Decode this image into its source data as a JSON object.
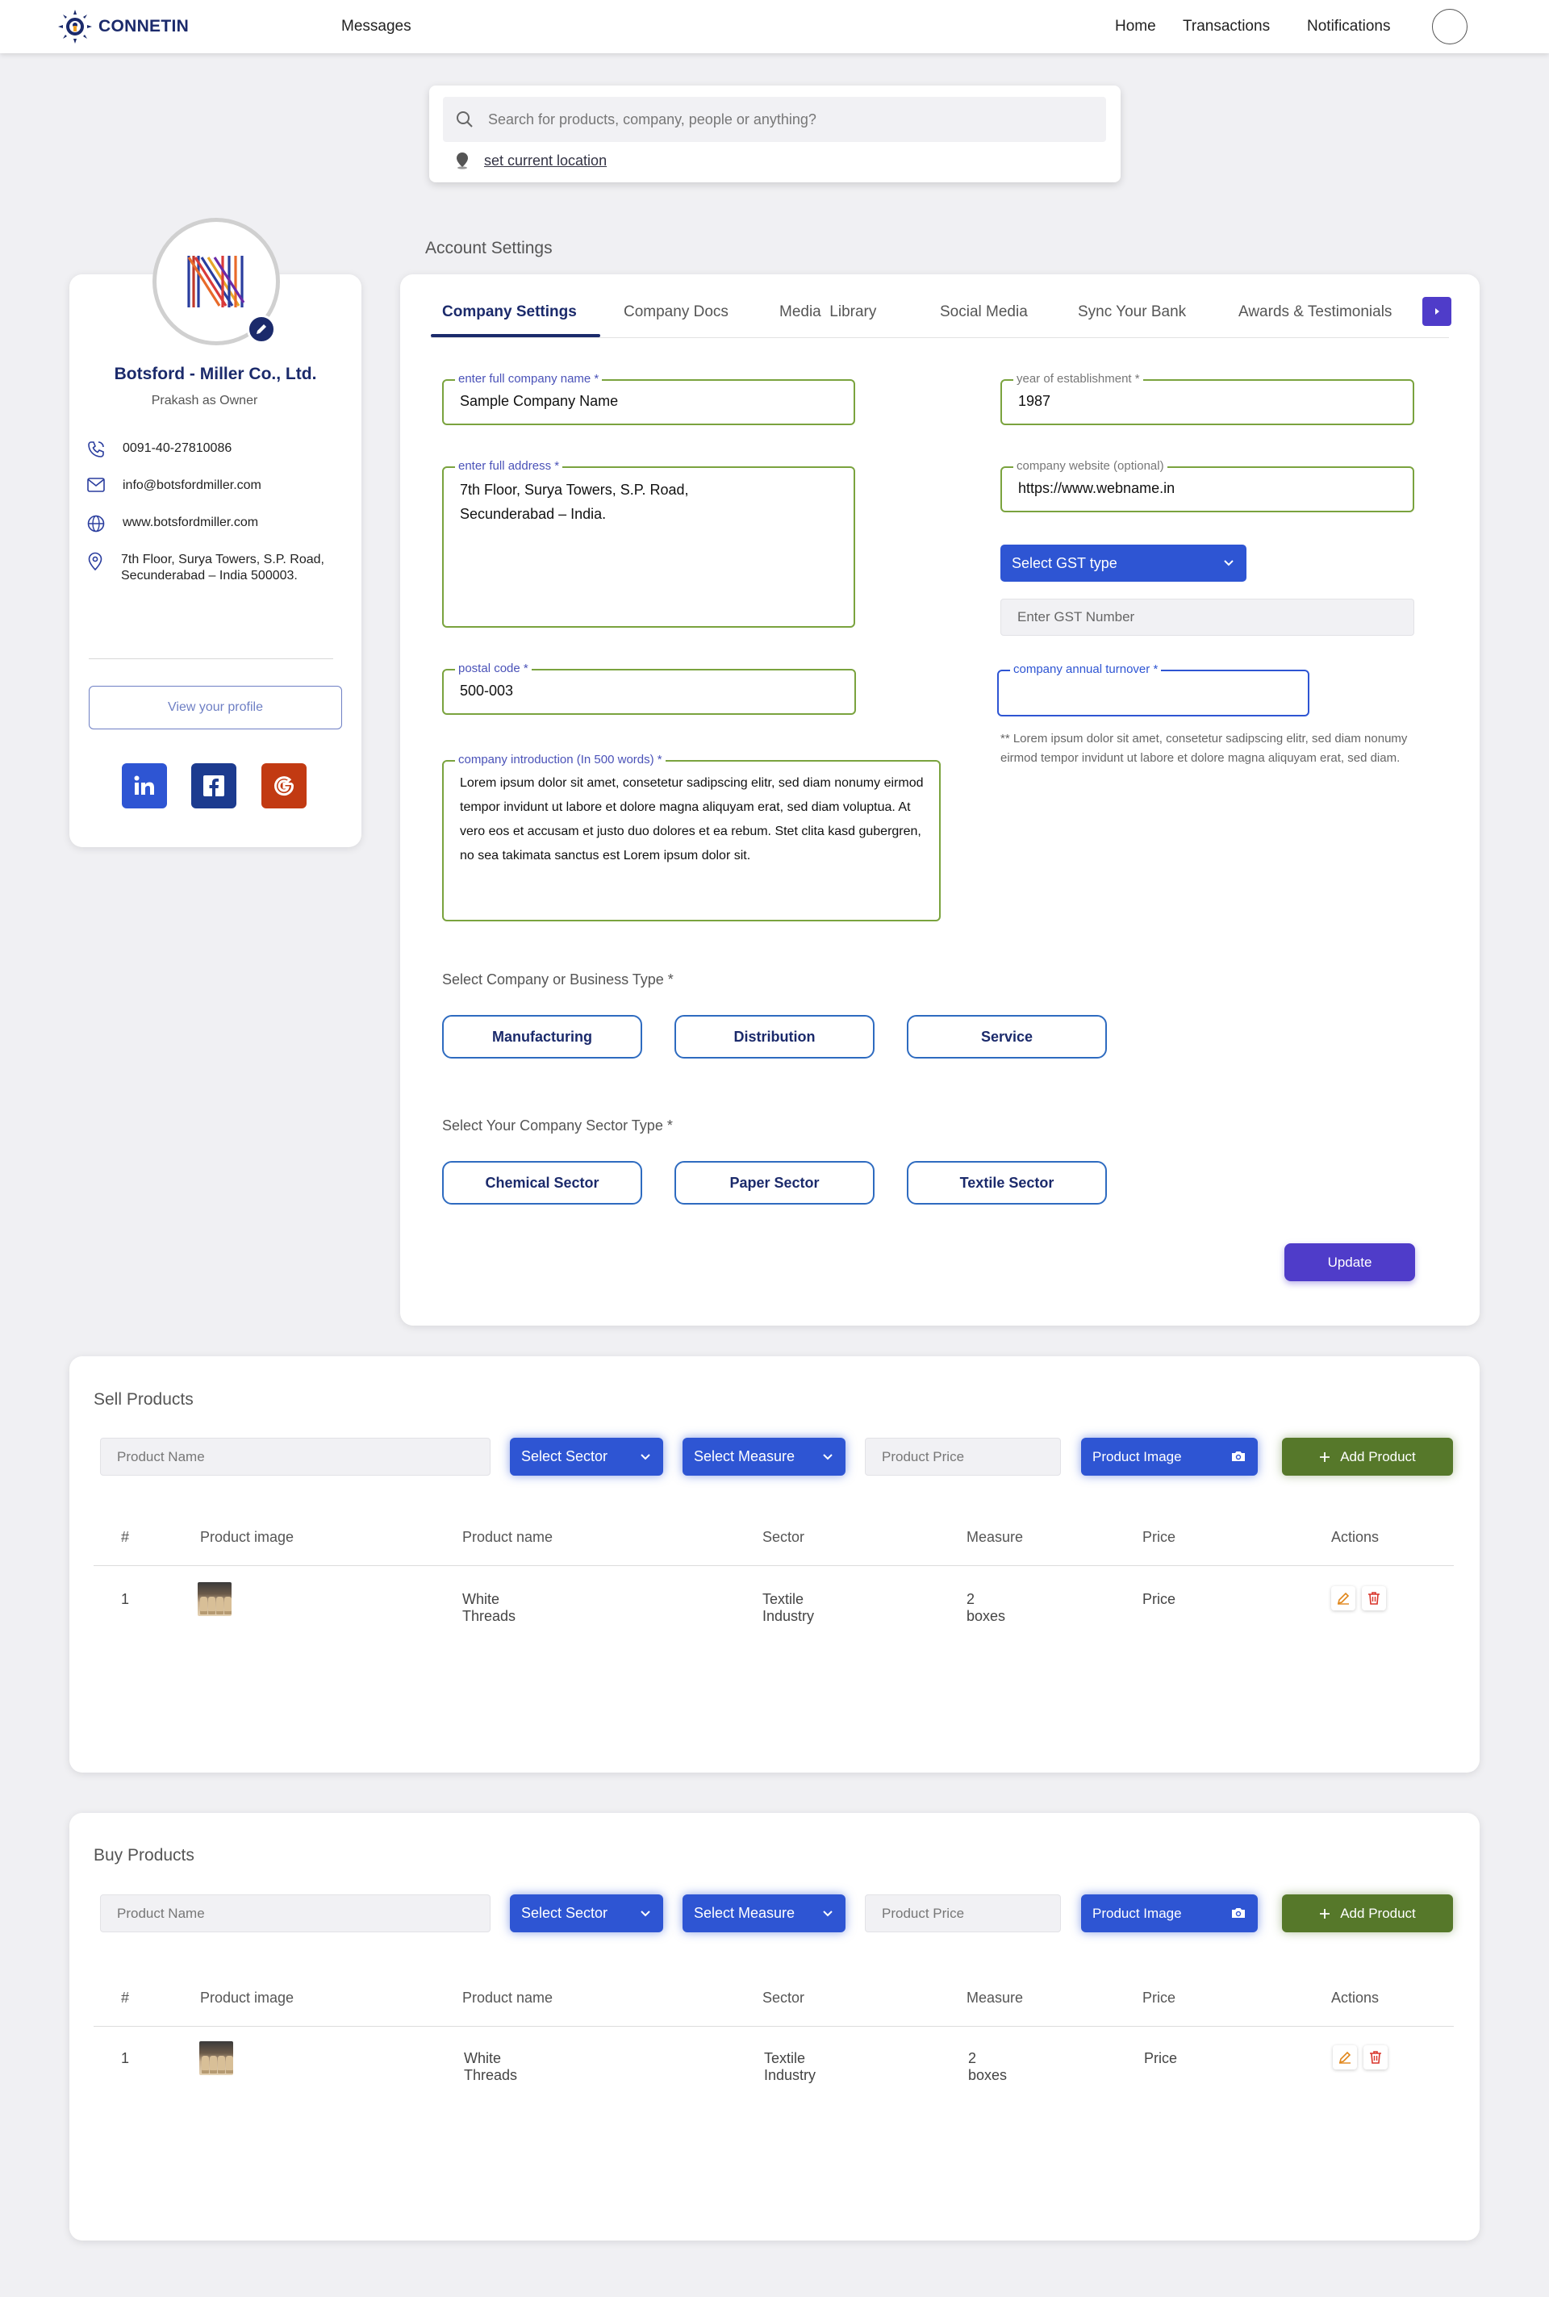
{
  "nav": {
    "brand": "CONNETIN",
    "messages": "Messages",
    "home": "Home",
    "transactions": "Transactions",
    "notifications": "Notifications"
  },
  "search": {
    "placeholder": "Search for products, company, people or anything?",
    "location_link": "set current location"
  },
  "account_settings_title": "Account Settings",
  "profile": {
    "company_name": "Botsford - Miller Co., Ltd.",
    "owner": "Prakash as Owner",
    "phone": "0091-40-27810086",
    "email": "info@botsfordmiller.com",
    "website": "www.botsfordmiller.com",
    "address_line1": "7th Floor, Surya Towers, S.P. Road,",
    "address_line2": "Secunderabad – India 500003.",
    "view_profile": "View your profile"
  },
  "tabs": [
    {
      "label": "Company Settings"
    },
    {
      "label": "Company Docs"
    },
    {
      "label": "Media  Library"
    },
    {
      "label": "Social Media"
    },
    {
      "label": "Sync Your Bank"
    },
    {
      "label": "Awards & Testimonials"
    }
  ],
  "form": {
    "company_name_label": "enter full company name *",
    "company_name_value": "Sample Company Name",
    "address_label": "enter full address *",
    "address_line1": "7th Floor, Surya Towers, S.P. Road,",
    "address_line2": "Secunderabad – India.",
    "postal_label": "postal code *",
    "postal_value": "500-003",
    "intro_label": "company introduction (In 500 words) *",
    "intro_text": "Lorem ipsum dolor sit amet, consetetur sadipscing elitr, sed diam nonumy eirmod tempor invidunt ut labore et dolore magna aliquyam erat, sed diam voluptua. At vero eos et accusam et justo duo dolores et ea rebum. Stet clita kasd gubergren, no sea takimata sanctus est Lorem ipsum dolor sit.",
    "year_label": "year of establishment *",
    "year_value": "1987",
    "website_label": "company website (optional)",
    "website_value": "https://www.webname.in",
    "gst_type": "Select GST type",
    "gst_number_placeholder": "Enter GST Number",
    "turnover_label": "company annual turnover *",
    "turnover_note": "** Lorem ipsum dolor sit amet, consetetur sadipscing elitr, sed diam nonumy eirmod tempor invidunt ut labore et dolore magna aliquyam erat, sed diam.",
    "business_type_label": "Select Company or Business Type *",
    "business_types": [
      "Manufacturing",
      "Distribution",
      "Service"
    ],
    "sector_type_label": "Select Your Company Sector Type *",
    "sector_types": [
      "Chemical Sector",
      "Paper Sector",
      "Textile Sector"
    ],
    "update": "Update"
  },
  "sell": {
    "title": "Sell Products",
    "product_name_placeholder": "Product Name",
    "select_sector": "Select Sector",
    "select_measure": "Select Measure",
    "product_price_placeholder": "Product Price",
    "product_image": "Product Image",
    "add_product": "Add Product",
    "headers": [
      "#",
      "Product image",
      "Product name",
      "Sector",
      "Measure",
      "Price",
      "Actions"
    ],
    "rows": [
      {
        "num": "1",
        "name": "White Threads",
        "sector": "Textile Industry",
        "measure": "2 boxes",
        "price": "Price"
      }
    ]
  },
  "buy": {
    "title": "Buy Products",
    "product_name_placeholder": "Product Name",
    "select_sector": "Select Sector",
    "select_measure": "Select Measure",
    "product_price_placeholder": "Product Price",
    "product_image": "Product Image",
    "add_product": "Add Product",
    "headers": [
      "#",
      "Product image",
      "Product name",
      "Sector",
      "Measure",
      "Price",
      "Actions"
    ],
    "rows": [
      {
        "num": "1",
        "name": "White Threads",
        "sector": "Textile Industry",
        "measure": "2 boxes",
        "price": "Price"
      }
    ]
  },
  "colors": {
    "brand_navy": "#1b2a6b",
    "primary_blue": "#2e55d3",
    "purple": "#4f3cc9",
    "green": "#56782a",
    "field_green": "#7aa33e"
  }
}
